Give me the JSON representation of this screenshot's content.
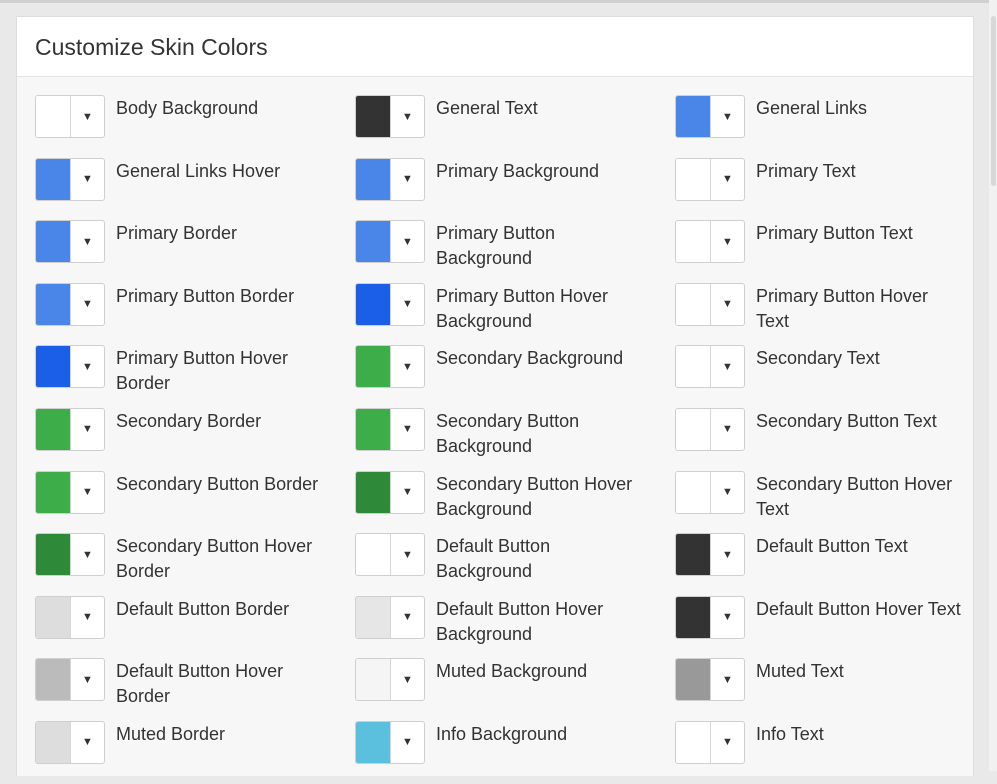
{
  "title": "Customize Skin Colors",
  "arrow_glyph": "▼",
  "items": [
    {
      "label": "Body Background",
      "color": "#ffffff"
    },
    {
      "label": "General Text",
      "color": "#333333"
    },
    {
      "label": "General Links",
      "color": "#4a86e8"
    },
    {
      "label": "General Links Hover",
      "color": "#4a86e8"
    },
    {
      "label": "Primary Background",
      "color": "#4a86e8"
    },
    {
      "label": "Primary Text",
      "color": "#ffffff"
    },
    {
      "label": "Primary Border",
      "color": "#4a86e8"
    },
    {
      "label": "Primary Button Background",
      "color": "#4a86e8"
    },
    {
      "label": "Primary Button Text",
      "color": "#ffffff"
    },
    {
      "label": "Primary Button Border",
      "color": "#4a86e8"
    },
    {
      "label": "Primary Button Hover Background",
      "color": "#1a5fe6"
    },
    {
      "label": "Primary Button Hover Text",
      "color": "#ffffff"
    },
    {
      "label": "Primary Button Hover Border",
      "color": "#1a5fe6"
    },
    {
      "label": "Secondary Background",
      "color": "#3cad48"
    },
    {
      "label": "Secondary Text",
      "color": "#ffffff"
    },
    {
      "label": "Secondary Border",
      "color": "#3cad48"
    },
    {
      "label": "Secondary Button Background",
      "color": "#3cad48"
    },
    {
      "label": "Secondary Button Text",
      "color": "#ffffff"
    },
    {
      "label": "Secondary Button Border",
      "color": "#3cad48"
    },
    {
      "label": "Secondary Button Hover Background",
      "color": "#2e8a38"
    },
    {
      "label": "Secondary Button Hover Text",
      "color": "#ffffff"
    },
    {
      "label": "Secondary Button Hover Border",
      "color": "#2e8a38"
    },
    {
      "label": "Default Button Background",
      "color": "#ffffff"
    },
    {
      "label": "Default Button Text",
      "color": "#333333"
    },
    {
      "label": "Default Button Border",
      "color": "#dddddd"
    },
    {
      "label": "Default Button Hover Background",
      "color": "#e6e6e6"
    },
    {
      "label": "Default Button Hover Text",
      "color": "#333333"
    },
    {
      "label": "Default Button Hover Border",
      "color": "#bbbbbb"
    },
    {
      "label": "Muted Background",
      "color": "#f5f5f5"
    },
    {
      "label": "Muted Text",
      "color": "#999999"
    },
    {
      "label": "Muted Border",
      "color": "#dddddd"
    },
    {
      "label": "Info Background",
      "color": "#5bc0de"
    },
    {
      "label": "Info Text",
      "color": "#ffffff"
    }
  ]
}
